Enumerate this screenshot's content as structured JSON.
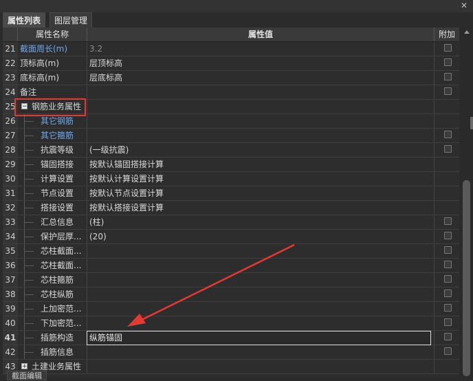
{
  "tabs": [
    {
      "label": "属性列表",
      "active": true
    },
    {
      "label": "图层管理",
      "active": false
    }
  ],
  "columns": {
    "name": "属性名称",
    "value": "属性值",
    "add": "附加"
  },
  "rows": [
    {
      "num": "21",
      "name": "截面周长(m)",
      "value": "3.2",
      "nameStyle": "blue",
      "valueStyle": "gray",
      "indent": 0,
      "checkbox": true
    },
    {
      "num": "22",
      "name": "顶标高(m)",
      "value": "层顶标高",
      "indent": 0,
      "checkbox": true
    },
    {
      "num": "23",
      "name": "底标高(m)",
      "value": "层底标高",
      "indent": 0,
      "checkbox": true
    },
    {
      "num": "24",
      "name": "备注",
      "value": "",
      "indent": 0,
      "checkbox": true
    },
    {
      "num": "25",
      "name": "钢筋业务属性",
      "value": "",
      "indent": 0,
      "group": "-",
      "checkbox": false
    },
    {
      "num": "26",
      "name": "其它钢筋",
      "value": "",
      "nameStyle": "blue",
      "indent": 1,
      "checkbox": false
    },
    {
      "num": "27",
      "name": "其它箍筋",
      "value": "",
      "nameStyle": "blue",
      "indent": 1,
      "checkbox": true
    },
    {
      "num": "28",
      "name": "抗震等级",
      "value": "(一级抗震)",
      "indent": 1,
      "checkbox": true
    },
    {
      "num": "29",
      "name": "锚固搭接",
      "value": "按默认锚固搭接计算",
      "indent": 1,
      "checkbox": false
    },
    {
      "num": "30",
      "name": "计算设置",
      "value": "按默认计算设置计算",
      "indent": 1,
      "checkbox": false
    },
    {
      "num": "31",
      "name": "节点设置",
      "value": "按默认节点设置计算",
      "indent": 1,
      "checkbox": false
    },
    {
      "num": "32",
      "name": "搭接设置",
      "value": "按默认搭接设置计算",
      "indent": 1,
      "checkbox": false
    },
    {
      "num": "33",
      "name": "汇总信息",
      "value": "(柱)",
      "indent": 1,
      "checkbox": true
    },
    {
      "num": "34",
      "name": "保护层厚...",
      "value": "(20)",
      "indent": 1,
      "checkbox": true
    },
    {
      "num": "35",
      "name": "芯柱截面...",
      "value": "",
      "indent": 1,
      "checkbox": true
    },
    {
      "num": "36",
      "name": "芯柱截面...",
      "value": "",
      "indent": 1,
      "checkbox": true
    },
    {
      "num": "37",
      "name": "芯柱箍筋",
      "value": "",
      "indent": 1,
      "checkbox": true
    },
    {
      "num": "38",
      "name": "芯柱纵筋",
      "value": "",
      "indent": 1,
      "checkbox": true
    },
    {
      "num": "39",
      "name": "上加密范...",
      "value": "",
      "indent": 1,
      "checkbox": true
    },
    {
      "num": "40",
      "name": "下加密范...",
      "value": "",
      "indent": 1,
      "checkbox": true
    },
    {
      "num": "41",
      "name": "插筋构造",
      "value": "纵筋锚固",
      "indent": 1,
      "checkbox": true,
      "editing": true
    },
    {
      "num": "42",
      "name": "插筋信息",
      "value": "",
      "indent": 1,
      "checkbox": true
    },
    {
      "num": "43",
      "name": "土建业务属性",
      "value": "",
      "indent": 0,
      "group": "+",
      "checkbox": false
    }
  ],
  "bottom_tab": "截面编辑",
  "colors": {
    "accent_red": "#e53935",
    "link_blue": "#6fa6ea"
  }
}
